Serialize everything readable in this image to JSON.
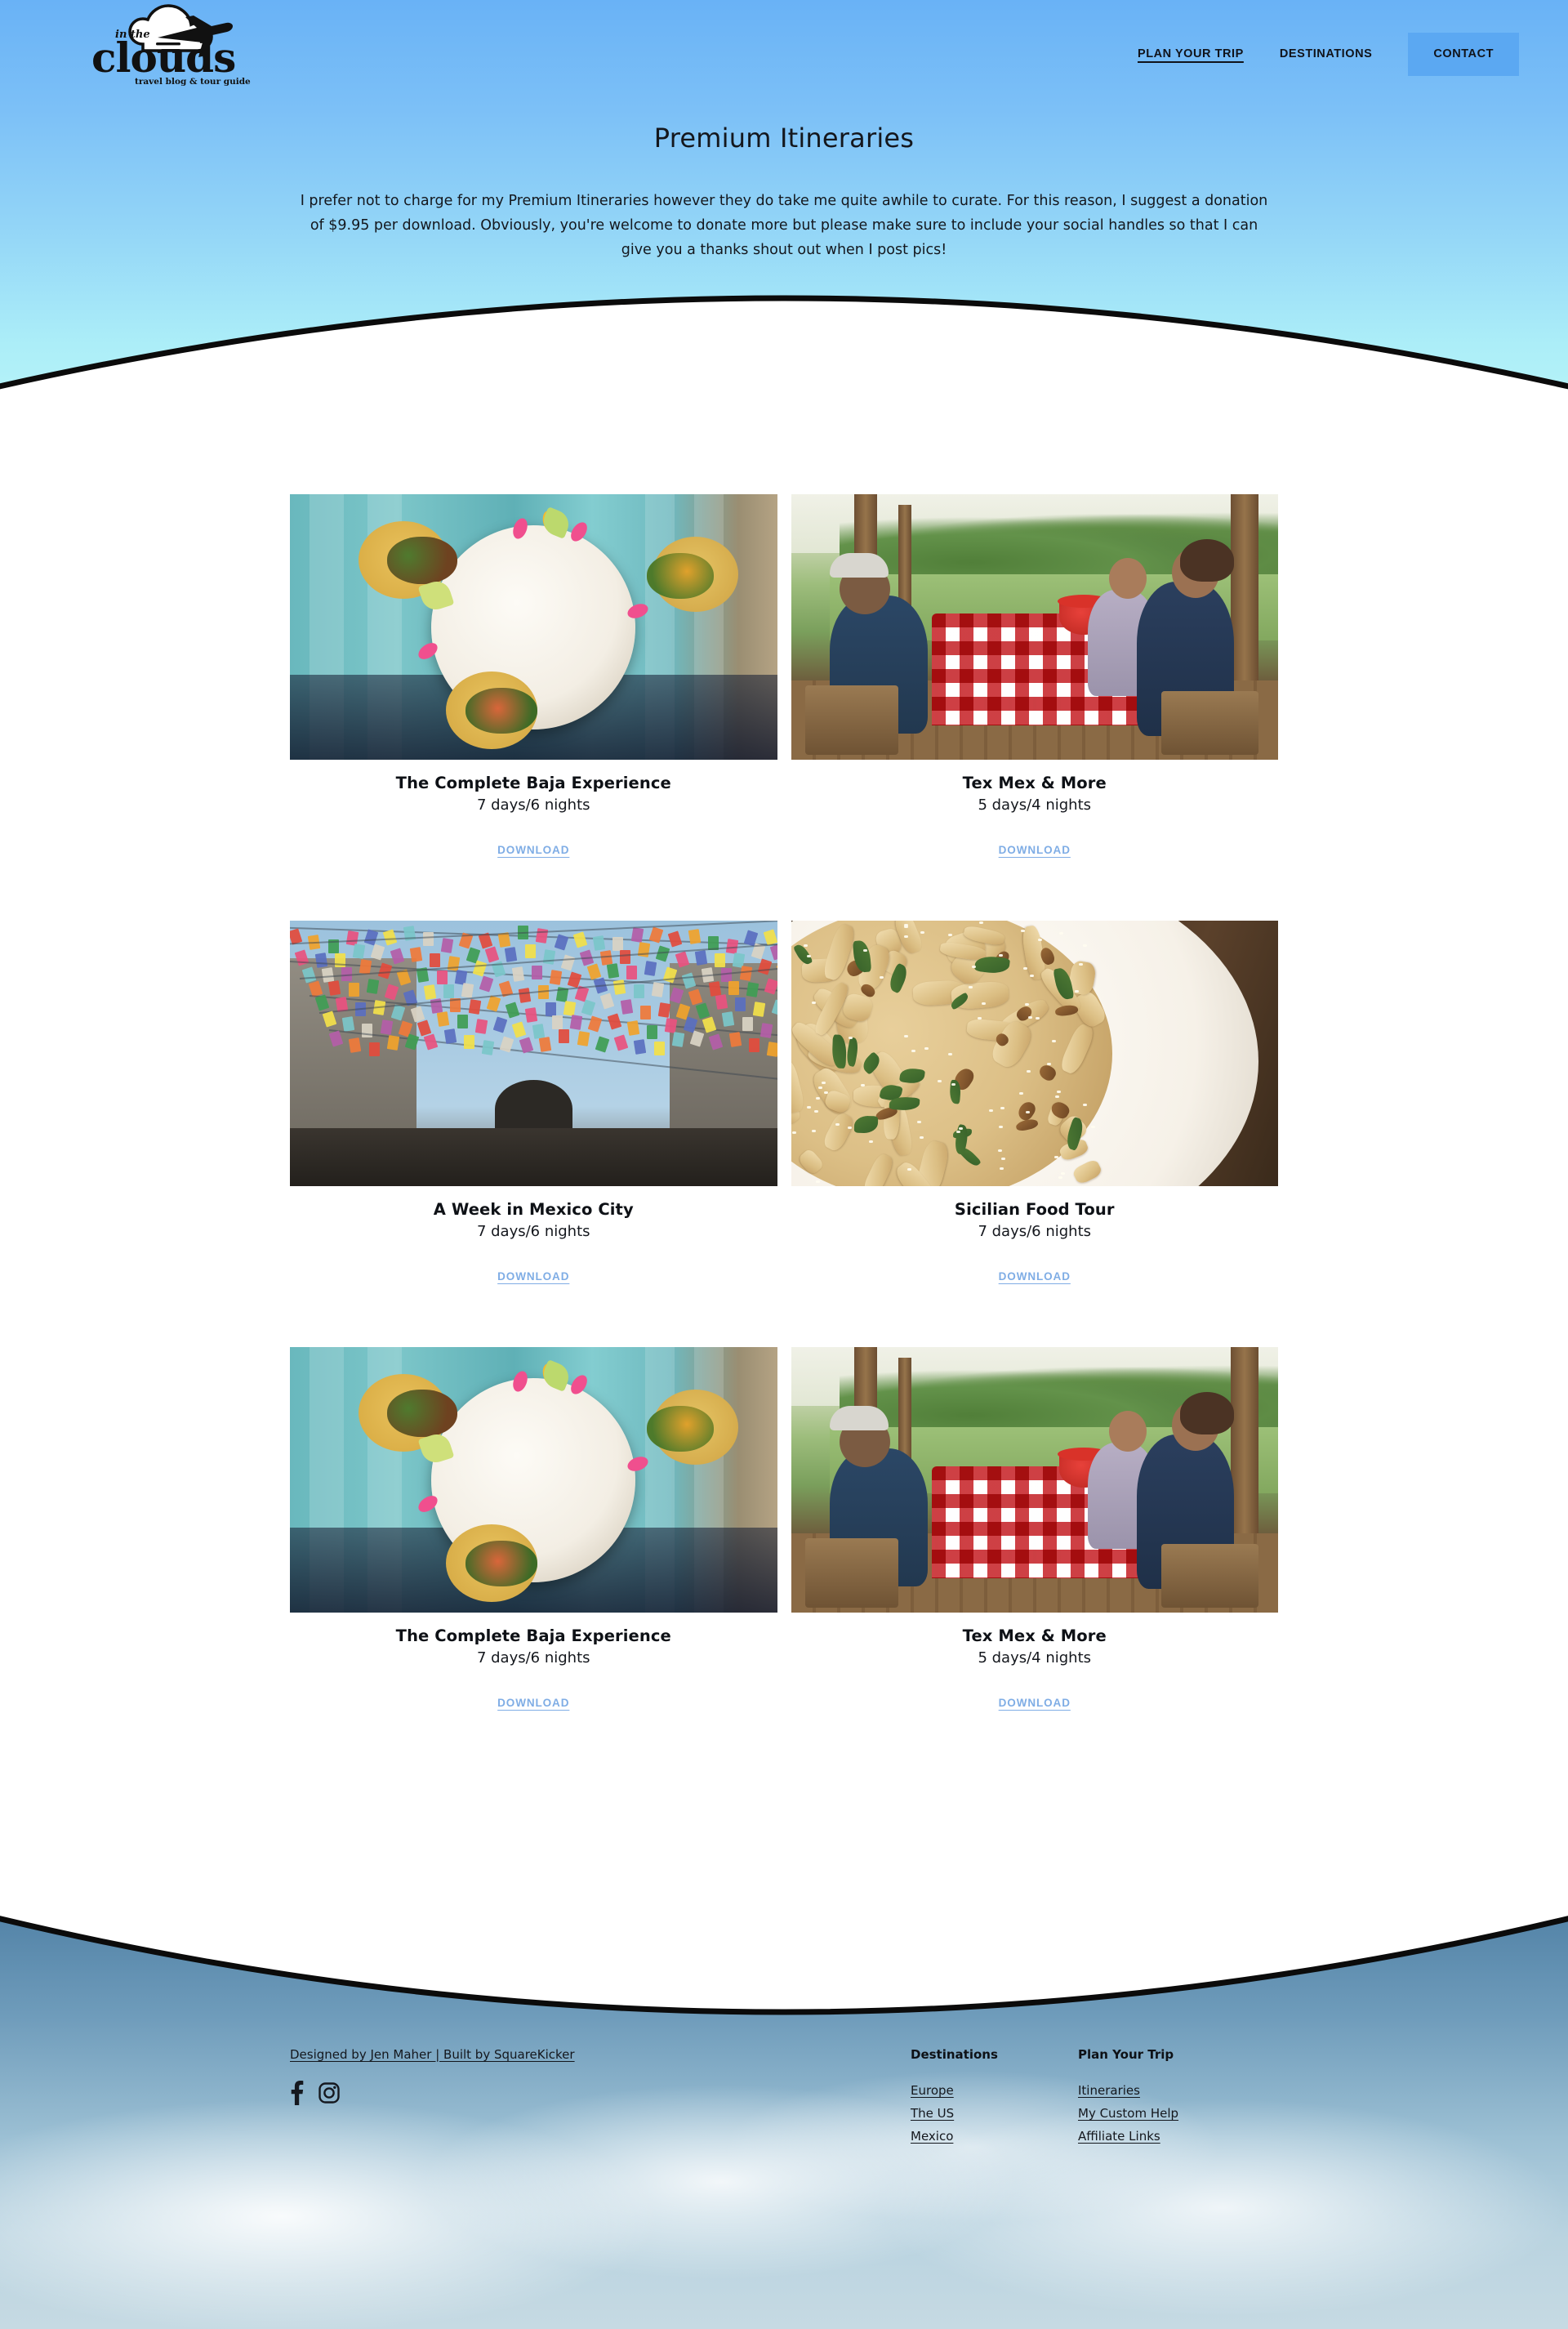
{
  "brand": {
    "name": "clouds",
    "prefix": "in the",
    "tagline": "travel blog & tour guide",
    "logo_icon": "cloud-airplane-icon"
  },
  "nav": {
    "links": [
      {
        "label": "PLAN YOUR TRIP",
        "active": true
      },
      {
        "label": "DESTINATIONS",
        "active": false
      }
    ],
    "cta": "CONTACT"
  },
  "hero": {
    "title": "Premium Itineraries",
    "body": "I prefer not to charge for my Premium Itineraries however they do take me quite awhile to curate. For this reason, I suggest a donation of $9.95 per download. Obviously, you're welcome to donate more but please make sure to include your social handles so that I can give you a thanks shout out when I post pics!"
  },
  "itineraries": [
    {
      "title": "The Complete Baja Experience",
      "duration": "7 days/6 nights",
      "download": "DOWNLOAD",
      "image": "tacos-on-turquoise-table"
    },
    {
      "title": "Tex Mex & More",
      "duration": "5 days/4 nights",
      "download": "DOWNLOAD",
      "image": "friends-picnic-table-red-gingham"
    },
    {
      "title": "A Week in Mexico City",
      "duration": "7 days/6 nights",
      "download": "DOWNLOAD",
      "image": "papel-picado-flags-over-building"
    },
    {
      "title": "Sicilian Food Tour",
      "duration": "7 days/6 nights",
      "download": "DOWNLOAD",
      "image": "pappardelle-pasta-with-sage"
    },
    {
      "title": "The Complete Baja Experience",
      "duration": "7 days/6 nights",
      "download": "DOWNLOAD",
      "image": "tacos-on-turquoise-table"
    },
    {
      "title": "Tex Mex & More",
      "duration": "5 days/4 nights",
      "download": "DOWNLOAD",
      "image": "friends-picnic-table-red-gingham"
    }
  ],
  "footer": {
    "credit": "Designed by Jen Maher | Built by SquareKicker",
    "social": [
      {
        "name": "facebook-icon"
      },
      {
        "name": "instagram-icon"
      }
    ],
    "columns": [
      {
        "heading": "Destinations",
        "links": [
          "Europe",
          "The US",
          "Mexico"
        ]
      },
      {
        "heading": "Plan Your Trip",
        "links": [
          "Itineraries",
          "My Custom Help",
          "Affiliate Links"
        ]
      }
    ]
  },
  "colors": {
    "hero_top": "#69b2f6",
    "hero_bottom": "#b4f2f8",
    "cta_bg": "#5ba8f2",
    "download_link": "#7fade5",
    "text": "#14171d"
  }
}
